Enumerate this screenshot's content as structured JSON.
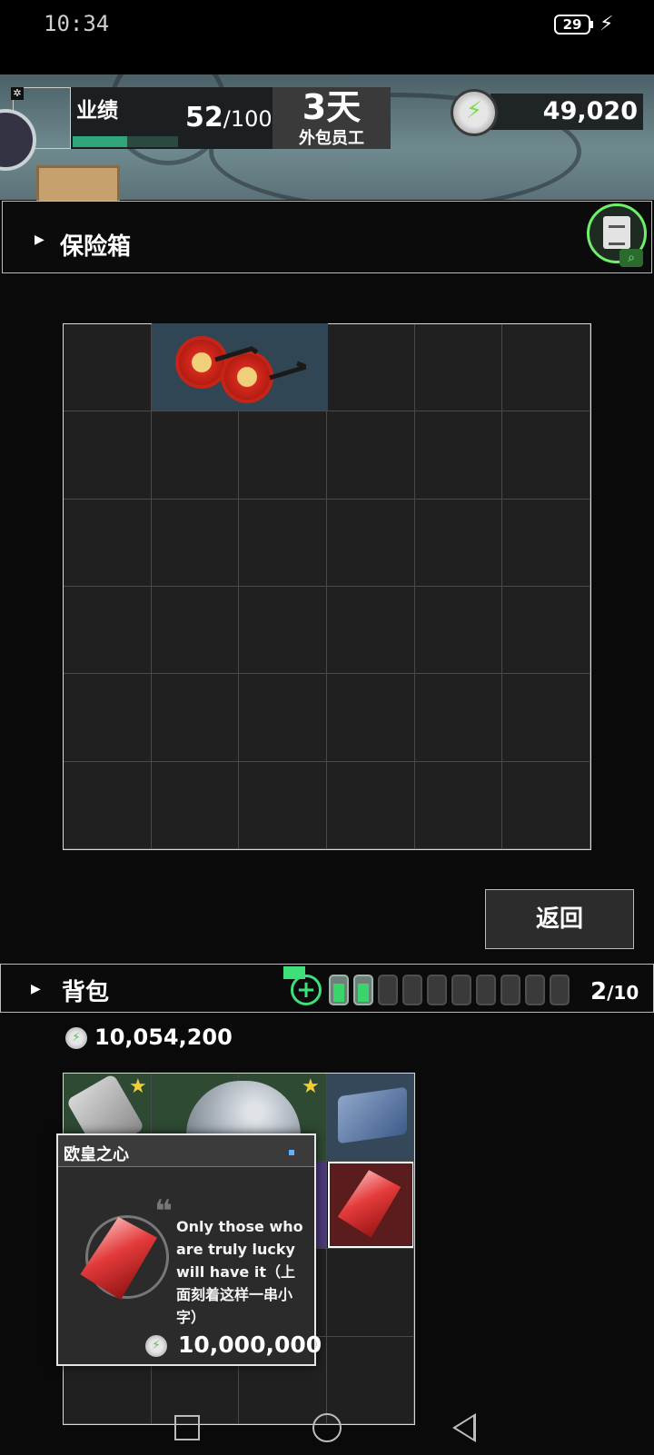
{
  "status_bar": {
    "time": "10:34",
    "battery": "29"
  },
  "top_bar": {
    "performance_label": "业绩",
    "performance_current": "52",
    "performance_max": "/100",
    "performance_fraction": 0.52,
    "days": "3天",
    "days_label": "外包员工",
    "coins": "49,020"
  },
  "safe": {
    "title": "保险箱",
    "return_label": "返回"
  },
  "backpack": {
    "title": "背包",
    "count": "2",
    "count_max": "/10",
    "batteries_filled": 2,
    "batteries_total": 10,
    "money": "10,054,200"
  },
  "tooltip": {
    "title": "欧皇之心",
    "description": "Only those who are truly lucky will have it（上面刻着这样一串小字）",
    "price": "10,000,000"
  },
  "icons": {
    "settings": "gear-icon",
    "coin": "lightning-coin-icon",
    "clipboard": "clipboard-search-icon",
    "add": "plus-icon",
    "battery": "battery-icon",
    "nav_recent": "square-icon",
    "nav_home": "circle-icon",
    "nav_back": "triangle-back-icon"
  },
  "colors": {
    "accent_green": "#3fe07c",
    "progress_green": "#2fa57a",
    "tooltip_dot": "#5ab4ff",
    "star": "#f2cd3a"
  }
}
